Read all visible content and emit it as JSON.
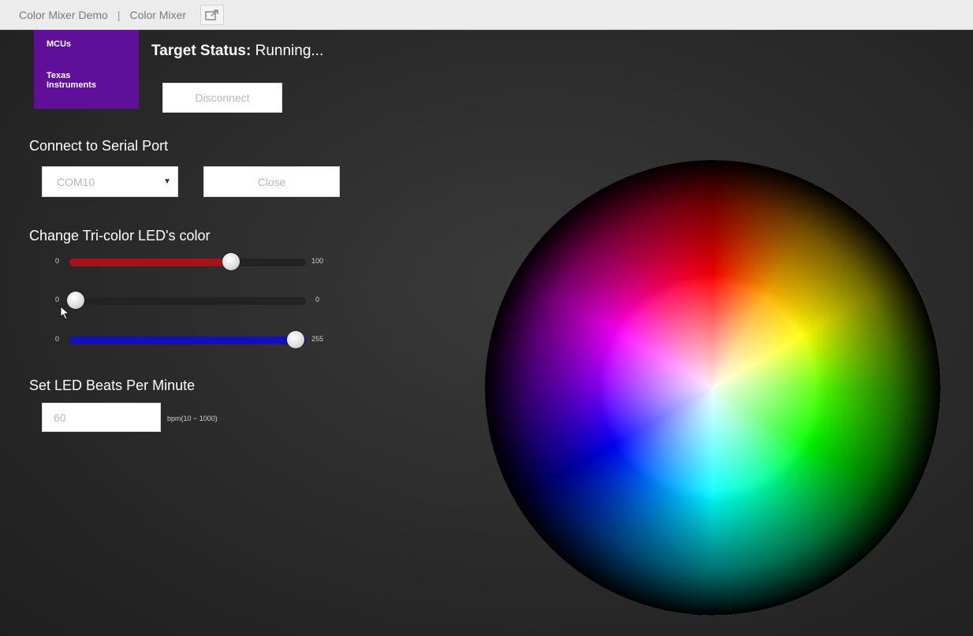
{
  "topbar": {
    "app_name": "Color Mixer Demo",
    "separator": "|",
    "page_name": "Color Mixer",
    "open_external_icon": "open-in-new-window-icon"
  },
  "logo": {
    "line1": "MCUs",
    "line2": "Texas Instruments",
    "color": "#5f0f9a"
  },
  "status": {
    "label": "Target Status:",
    "value": "Running..."
  },
  "disconnect_button": "Disconnect",
  "serial": {
    "heading": "Connect to Serial Port",
    "port_value": "COM10",
    "close_button": "Close"
  },
  "led": {
    "heading": "Change Tri-color LED's color",
    "red": {
      "min": "0",
      "max": "100",
      "value": 70,
      "color": "#a5121a"
    },
    "green": {
      "min": "0",
      "max": "0",
      "value": 0,
      "color": "#2a2a2a"
    },
    "blue": {
      "min": "0",
      "max": "255",
      "value": 255,
      "color": "#1410b8"
    }
  },
  "bpm": {
    "heading": "Set LED Beats Per Minute",
    "value": "60",
    "range_hint": "bpm(10 ~ 1000)"
  },
  "color_wheel": {
    "icon": "color-wheel"
  }
}
